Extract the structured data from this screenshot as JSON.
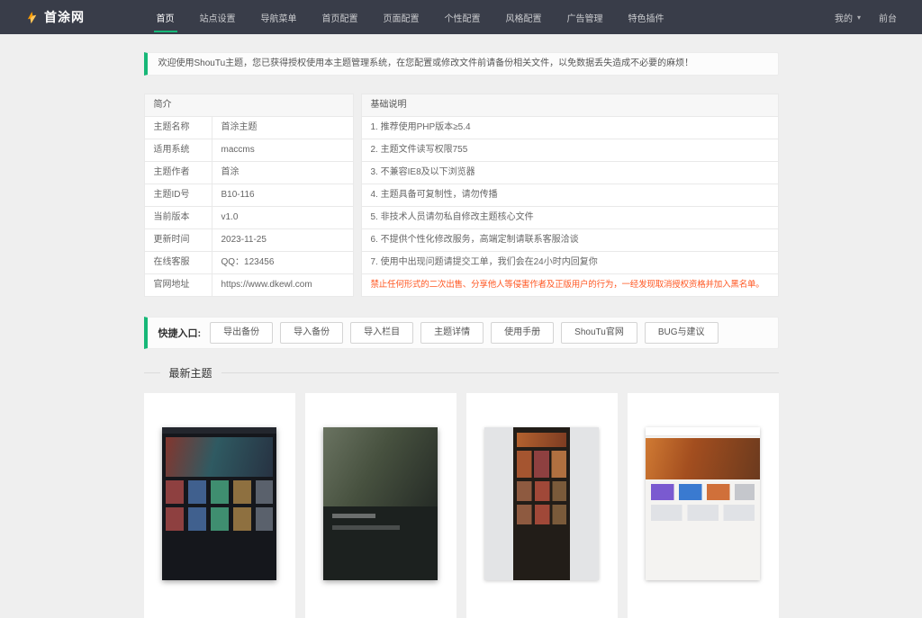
{
  "colors": {
    "navbar_bg": "#393d49",
    "accent_green": "#16b777",
    "danger_red": "#ff5722",
    "page_bg": "#efefef"
  },
  "navbar": {
    "logo": "首涂网",
    "items": [
      {
        "label": "首页",
        "active": true
      },
      {
        "label": "站点设置"
      },
      {
        "label": "导航菜单"
      },
      {
        "label": "首页配置"
      },
      {
        "label": "页面配置"
      },
      {
        "label": "个性配置"
      },
      {
        "label": "风格配置"
      },
      {
        "label": "广告管理"
      },
      {
        "label": "特色插件"
      }
    ],
    "right": [
      {
        "label": "我的",
        "caret": "▾"
      },
      {
        "label": "前台"
      }
    ]
  },
  "welcome": {
    "text": "欢迎使用ShouTu主题，您已获得授权使用本主题管理系统，在您配置或修改文件前请备份相关文件，以免数据丢失造成不必要的麻烦！"
  },
  "intro_table": {
    "header": "简介",
    "rows": [
      {
        "label": "主题名称",
        "value": "首涂主题"
      },
      {
        "label": "适用系统",
        "value": "maccms"
      },
      {
        "label": "主题作者",
        "value": "首涂"
      },
      {
        "label": "主题ID号",
        "value": "B10-116"
      },
      {
        "label": "当前版本",
        "value": "v1.0"
      },
      {
        "label": "更新时间",
        "value": "2023-11-25"
      },
      {
        "label": "在线客服",
        "value": "QQ：123456"
      },
      {
        "label": "官网地址",
        "value": "https://www.dkewl.com"
      }
    ]
  },
  "info_table": {
    "header": "基础说明",
    "rows": [
      {
        "text": "1. 推荐使用PHP版本≥5.4"
      },
      {
        "text": "2. 主题文件读写权限755"
      },
      {
        "text": "3. 不兼容IE8及以下浏览器"
      },
      {
        "text": "4. 主题具备可复制性，请勿传播"
      },
      {
        "text": "5. 非技术人员请勿私自修改主题核心文件"
      },
      {
        "text": "6. 不提供个性化修改服务，高端定制请联系客服洽谈"
      },
      {
        "text": "7. 使用中出现问题请提交工单，我们会在24小时内回复你"
      },
      {
        "text": "禁止任何形式的二次出售、分享他人等侵害作者及正版用户的行为，一经发现取消授权资格并加入黑名单。",
        "type": "danger"
      }
    ]
  },
  "quick_entry": {
    "label": "快捷入口:",
    "buttons": [
      "导出备份",
      "导入备份",
      "导入栏目",
      "主题详情",
      "使用手册",
      "ShouTu官网",
      "BUG与建议"
    ]
  },
  "latest_section": {
    "title": "最新主题"
  },
  "themes": [
    {
      "variant": "dark-grid"
    },
    {
      "variant": "dark-hero"
    },
    {
      "variant": "mobile-warm"
    },
    {
      "variant": "light-hero"
    }
  ]
}
